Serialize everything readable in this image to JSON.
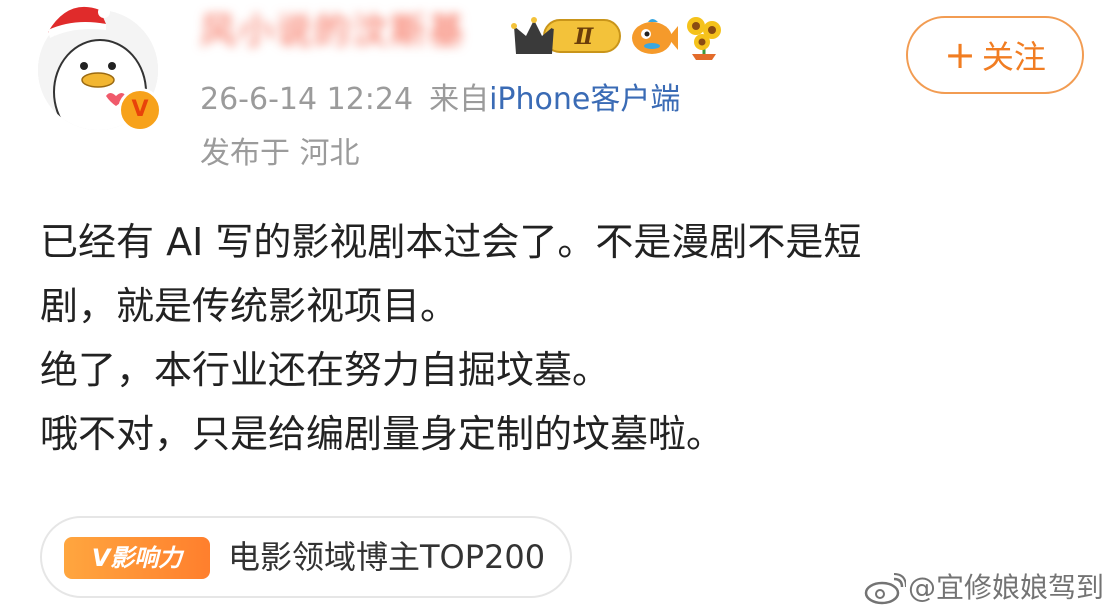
{
  "post": {
    "author": {
      "username": "风小说的汶斯基",
      "avatar_icon": "duck-santa-avatar-icon",
      "verified_badge": "V",
      "level_badge": "Ⅱ",
      "extra_icons": [
        "crown-level-badge-icon",
        "fish-icon",
        "sunflower-icon"
      ]
    },
    "follow_label": "关注",
    "follow_plus": "+",
    "timestamp": "26-6-14 12:24",
    "from_label": "来自",
    "source": "iPhone客户端",
    "location": "发布于 河北",
    "body_lines": [
      "已经有 AI 写的影视剧本过会了。不是漫剧不是短",
      "剧，就是传统影视项目。",
      "绝了，本行业还在努力自掘坟墓。",
      "哦不对，只是给编剧量身定制的坟墓啦。"
    ]
  },
  "influence": {
    "badge_prefix": "V",
    "badge_label": "影响力",
    "text": "电影领域博主TOP200"
  },
  "watermark": {
    "icon": "weibo-logo-icon",
    "text": "@宜修娘娘驾到"
  },
  "colors": {
    "accent_orange": "#f17d22",
    "link_blue": "#3a6bb5",
    "meta_gray": "#9b9b9b",
    "text_dark": "#222222"
  }
}
